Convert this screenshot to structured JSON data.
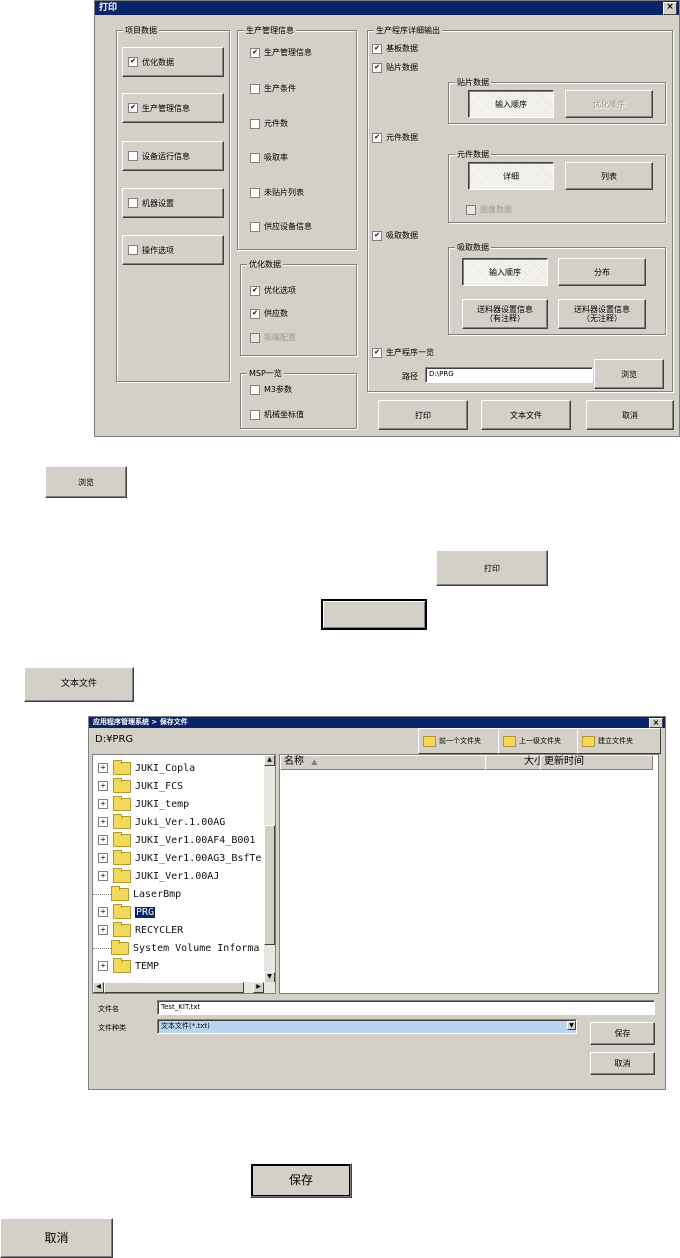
{
  "print_dialog": {
    "title": "打印",
    "project_data": {
      "label": "项目数据",
      "items": [
        {
          "label": "优化数据",
          "checked": true
        },
        {
          "label": "生产管理信息",
          "checked": true
        },
        {
          "label": "设备运行信息",
          "checked": false
        },
        {
          "label": "机器设置",
          "checked": false
        },
        {
          "label": "操作选项",
          "checked": false
        }
      ]
    },
    "production_mgmt": {
      "label": "生产管理信息",
      "items": [
        {
          "label": "生产管理信息",
          "checked": true
        },
        {
          "label": "生产条件",
          "checked": false
        },
        {
          "label": "元件数",
          "checked": false
        },
        {
          "label": "吸取率",
          "checked": false
        },
        {
          "label": "未贴片列表",
          "checked": false
        },
        {
          "label": "供应设备信息",
          "checked": false
        }
      ]
    },
    "optimize_data": {
      "label": "优化数据",
      "items": [
        {
          "label": "优化选项",
          "checked": true
        },
        {
          "label": "供应数",
          "checked": true
        },
        {
          "label": "吸嘴配置",
          "checked": false,
          "disabled": true
        }
      ]
    },
    "msp_list": {
      "label": "MSP一览",
      "items": [
        {
          "label": "M3参数",
          "checked": false
        },
        {
          "label": "机械坐标值",
          "checked": false
        }
      ]
    },
    "detail_output": {
      "label": "生产程序详细输出",
      "basic_data": {
        "label": "基板数据",
        "checked": true
      },
      "placement_data": {
        "label": "贴片数据",
        "checked": true
      },
      "placement_group": {
        "label": "贴片数据",
        "input_order": "输入顺序",
        "optimize_order": "优化顺序"
      },
      "component_data": {
        "label": "元件数据",
        "checked": true
      },
      "component_group": {
        "label": "元件数据",
        "detail": "详细",
        "list": "列表",
        "image_data": "图像数据"
      },
      "pickup_data": {
        "label": "吸取数据",
        "checked": true
      },
      "pickup_group": {
        "label": "吸取数据",
        "input_order": "输入顺序",
        "distribution": "分布",
        "feeder_with_notes": "送料器设置信息\n（有注释）",
        "feeder_no_notes": "送料器设置信息\n（无注释）"
      },
      "program_list": {
        "label": "生产程序一览",
        "checked": true
      },
      "path_label": "路径",
      "path_value": "D:\\PRG",
      "browse": "浏览"
    },
    "buttons": {
      "print": "打印",
      "text_file": "文本文件",
      "cancel": "取消"
    }
  },
  "standalone": {
    "browse": "浏览",
    "print": "打印",
    "text_file": "文本文件",
    "save": "保存",
    "cancel": "取消"
  },
  "save_dialog": {
    "title": "应用程序管理系统 > 保存文件",
    "current_path": "D:¥PRG",
    "toolbar": {
      "previous": "前一个文件夹",
      "up": "上一级文件夹",
      "new_folder": "建立文件夹"
    },
    "folders": [
      {
        "name": "JUKI_Copla",
        "expandable": true,
        "selected": false
      },
      {
        "name": "JUKI_FCS",
        "expandable": true,
        "selected": false
      },
      {
        "name": "JUKI_temp",
        "expandable": true,
        "selected": false
      },
      {
        "name": "Juki_Ver.1.00AG",
        "expandable": true,
        "selected": false
      },
      {
        "name": "JUKI_Ver1.00AF4_B001",
        "expandable": true,
        "selected": false
      },
      {
        "name": "JUKI_Ver1.00AG3_BsfTe",
        "expandable": true,
        "selected": false
      },
      {
        "name": "JUKI_Ver1.00AJ",
        "expandable": true,
        "selected": false
      },
      {
        "name": "LaserBmp",
        "expandable": false,
        "selected": false
      },
      {
        "name": "PRG",
        "expandable": true,
        "selected": true
      },
      {
        "name": "RECYCLER",
        "expandable": true,
        "selected": false
      },
      {
        "name": "System Volume Informa",
        "expandable": false,
        "selected": false
      },
      {
        "name": "TEMP",
        "expandable": true,
        "selected": false
      }
    ],
    "columns": {
      "name": "名称",
      "size": "大小",
      "modified": "更新时间"
    },
    "filename_label": "文件名",
    "filename_value": "Test_KIT.txt",
    "filetype_label": "文件种类",
    "filetype_value": "文本文件(*.txt)",
    "save": "保存",
    "cancel": "取消"
  }
}
